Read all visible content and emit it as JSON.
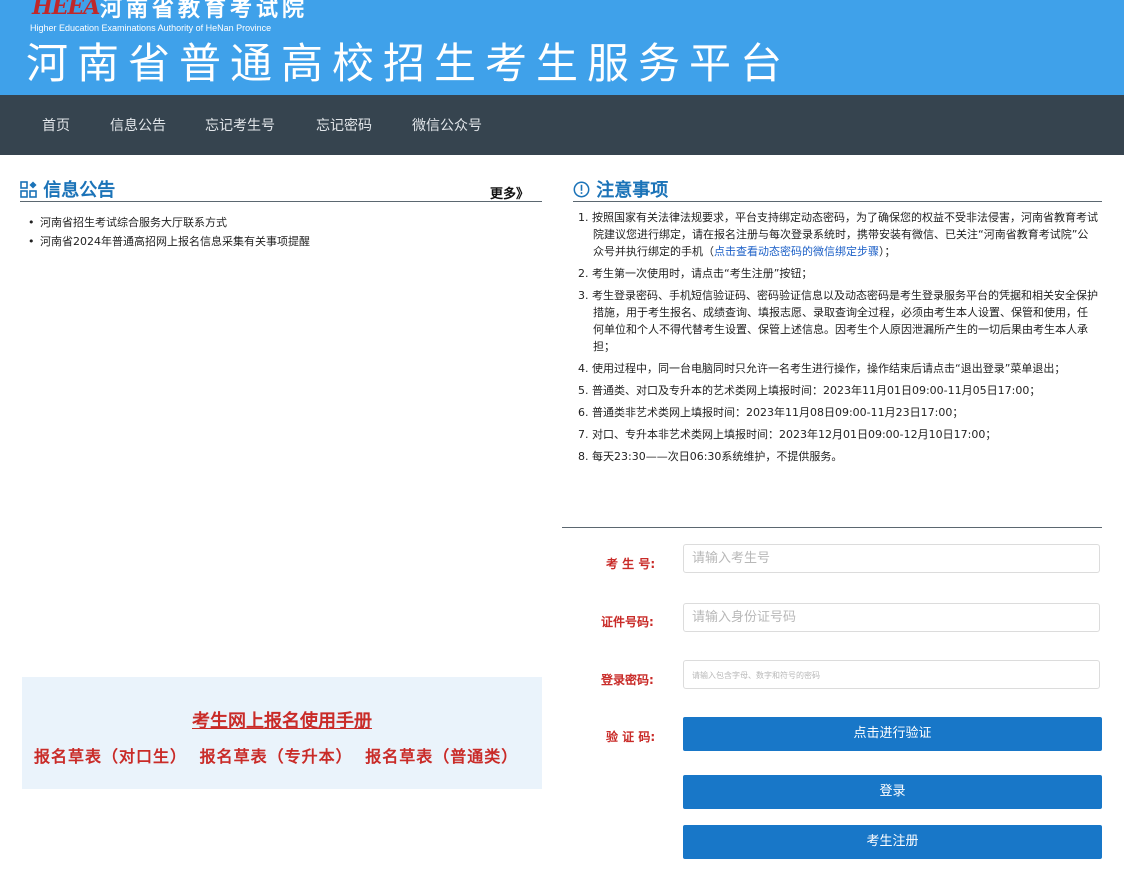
{
  "header": {
    "logo_text": "HEEA",
    "org_name_cn": "河南省教育考试院",
    "org_name_en": "Higher Education Examinations Authority of HeNan Province",
    "platform_title": "河南省普通高校招生考生服务平台"
  },
  "nav": {
    "items": [
      "首页",
      "信息公告",
      "忘记考生号",
      "忘记密码",
      "微信公众号"
    ]
  },
  "notice": {
    "title": "信息公告",
    "more": "更多》",
    "items": [
      "河南省招生考试综合服务大厅联系方式",
      "河南省2024年普通高招网上报名信息采集有关事项提醒"
    ]
  },
  "manual": {
    "title": "考生网上报名使用手册",
    "forms": [
      "报名草表（对口生）",
      "报名草表（专升本）",
      "报名草表（普通类）"
    ]
  },
  "attention": {
    "title": "注意事项",
    "items": [
      {
        "text": "1. 按照国家有关法律法规要求，平台支持绑定动态密码，为了确保您的权益不受非法侵害，河南省教育考试院建议您进行绑定，请在报名注册与每次登录系统时，携带安装有微信、已关注“河南省教育考试院”公众号并执行绑定的手机（",
        "link": "点击查看动态密码的微信绑定步骤",
        "tail": "）；"
      },
      {
        "text": "2. 考生第一次使用时，请点击“考生注册”按钮；"
      },
      {
        "text": "3. 考生登录密码、手机短信验证码、密码验证信息以及动态密码是考生登录服务平台的凭据和相关安全保护措施，用于考生报名、成绩查询、填报志愿、录取查询全过程，必须由考生本人设置、保管和使用，任何单位和个人不得代替考生设置、保管上述信息。因考生个人原因泄漏所产生的一切后果由考生本人承担；"
      },
      {
        "text": "4. 使用过程中，同一台电脑同时只允许一名考生进行操作，操作结束后请点击“退出登录”菜单退出；"
      },
      {
        "text": "5. 普通类、对口及专升本的艺术类网上填报时间：2023年11月01日09:00-11月05日17:00；"
      },
      {
        "text": "6. 普通类非艺术类网上填报时间：2023年11月08日09:00-11月23日17:00；"
      },
      {
        "text": "7. 对口、专升本非艺术类网上填报时间：2023年12月01日09:00-12月10日17:00；"
      },
      {
        "text": "8. 每天23:30——次日06:30系统维护，不提供服务。"
      }
    ]
  },
  "login": {
    "exam_no_label": "考 生 号:",
    "exam_no_placeholder": "请输入考生号",
    "id_label": "证件号码:",
    "id_placeholder": "请输入身份证号码",
    "pwd_label": "登录密码:",
    "pwd_placeholder": "请输入包含字母、数字和符号的密码",
    "captcha_label": "验 证 码:",
    "verify_button": "点击进行验证",
    "login_button": "登录",
    "register_button": "考生注册"
  },
  "colors": {
    "header_bg": "#3fa1ea",
    "nav_bg": "#36444f",
    "accent_blue": "#1b73b8",
    "button_blue": "#1877c8",
    "label_red": "#c92b28"
  }
}
